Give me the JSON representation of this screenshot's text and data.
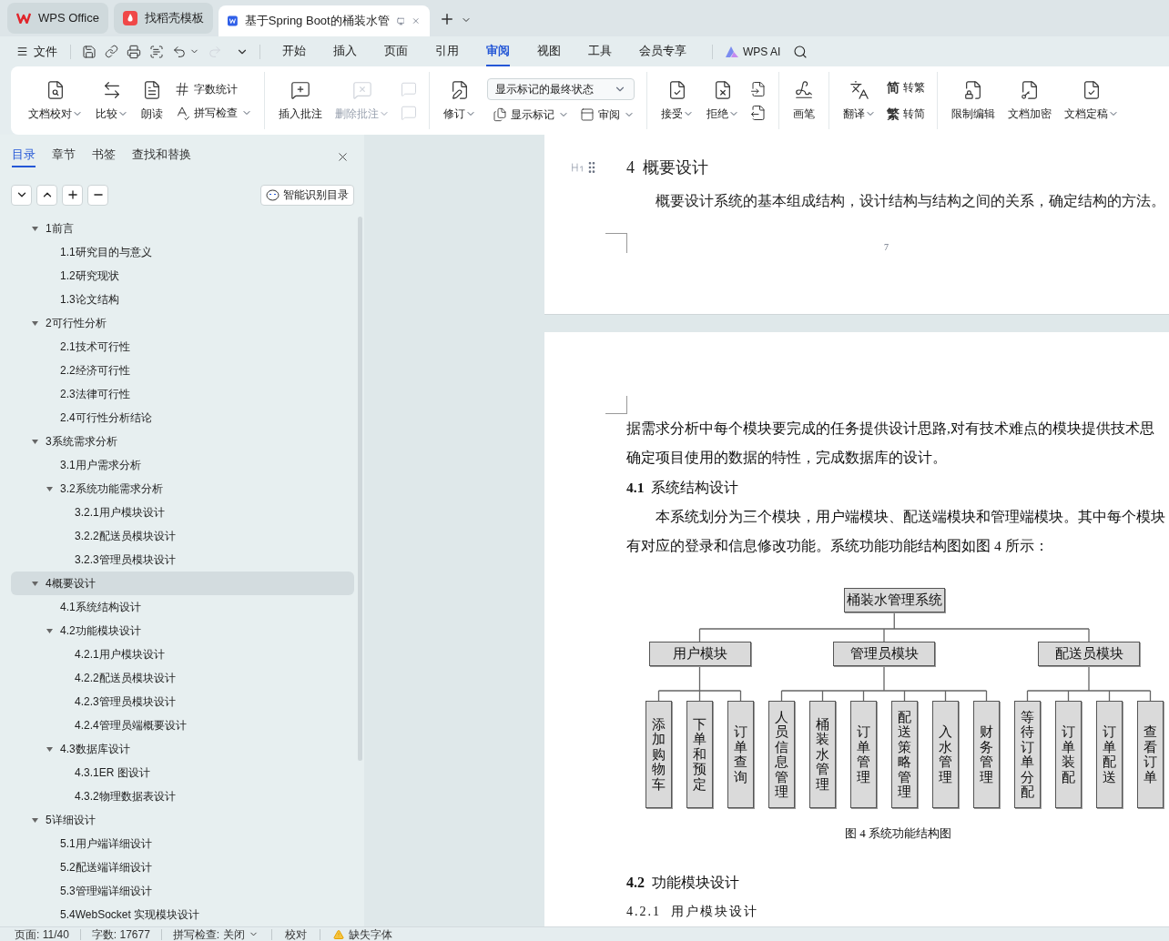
{
  "browser_tabs": [
    {
      "kind": "home",
      "label": "WPS Office",
      "selected": false
    },
    {
      "kind": "template",
      "label": "找稻壳模板",
      "selected": false
    },
    {
      "kind": "doc",
      "label": "基于Spring Boot的桶装水管",
      "selected": true
    }
  ],
  "menu": {
    "file": "文件",
    "tabs": [
      {
        "label": "开始",
        "selected": false
      },
      {
        "label": "插入",
        "selected": false
      },
      {
        "label": "页面",
        "selected": false
      },
      {
        "label": "引用",
        "selected": false
      },
      {
        "label": "审阅",
        "selected": true
      },
      {
        "label": "视图",
        "selected": false
      },
      {
        "label": "工具",
        "selected": false
      },
      {
        "label": "会员专享",
        "selected": false
      }
    ],
    "ai": "WPS AI"
  },
  "ribbon": [
    {
      "controls": [
        {
          "kind": "big",
          "label": "文档校对",
          "has_menu": true,
          "disabled": false
        },
        {
          "kind": "big",
          "label": "比较",
          "has_menu": true,
          "disabled": false
        },
        {
          "kind": "big",
          "label": "朗读",
          "has_menu": false,
          "disabled": false
        },
        {
          "kind": "stack",
          "items": [
            {
              "label": "字数统计",
              "has_menu": false,
              "disabled": false
            },
            {
              "label": "拼写检查",
              "has_menu": true,
              "disabled": false
            }
          ]
        }
      ]
    },
    {
      "controls": [
        {
          "kind": "big",
          "label": "插入批注",
          "has_menu": false,
          "disabled": false
        },
        {
          "kind": "big",
          "label": "删除批注",
          "has_menu": true,
          "disabled": true
        },
        {
          "kind": "stack",
          "items": [
            {
              "has_menu": false,
              "disabled": true
            },
            {
              "has_menu": false,
              "disabled": true
            }
          ]
        }
      ]
    },
    {
      "controls": [
        {
          "kind": "big",
          "label": "修订",
          "has_menu": true,
          "disabled": false
        },
        {
          "kind": "panel",
          "select": "显示标记的最终状态",
          "items": [
            {
              "label": "显示标记",
              "has_menu": true,
              "disabled": false
            },
            {
              "label": "审阅",
              "has_menu": true,
              "disabled": false
            }
          ]
        }
      ]
    },
    {
      "controls": [
        {
          "kind": "big",
          "label": "接受",
          "has_menu": true,
          "disabled": false
        },
        {
          "kind": "big",
          "label": "拒绝",
          "has_menu": true,
          "disabled": false
        },
        {
          "kind": "stack",
          "items": [
            {
              "has_menu": false,
              "disabled": false
            },
            {
              "has_menu": false,
              "disabled": false
            }
          ]
        }
      ]
    },
    {
      "controls": [
        {
          "kind": "big",
          "label": "画笔",
          "has_menu": false,
          "disabled": false
        }
      ]
    },
    {
      "controls": [
        {
          "kind": "big",
          "label": "翻译",
          "has_menu": true,
          "disabled": false
        },
        {
          "kind": "stack",
          "items": [
            {
              "glyph": "简",
              "label": "转繁",
              "has_menu": false,
              "disabled": false
            },
            {
              "glyph": "繁",
              "label": "转简",
              "has_menu": false,
              "disabled": false
            }
          ]
        }
      ]
    },
    {
      "controls": [
        {
          "kind": "big",
          "label": "限制编辑",
          "has_menu": false,
          "disabled": false
        },
        {
          "kind": "big",
          "label": "文档加密",
          "has_menu": false,
          "disabled": false
        },
        {
          "kind": "big",
          "label": "文档定稿",
          "has_menu": true,
          "disabled": false
        }
      ]
    }
  ],
  "sidebar": {
    "tabs": [
      {
        "label": "目录",
        "selected": true
      },
      {
        "label": "章节",
        "selected": false
      },
      {
        "label": "书签",
        "selected": false
      },
      {
        "label": "查找和替换",
        "selected": false
      }
    ],
    "smart_toc_button": "智能识别目录"
  },
  "toc": {
    "items": [
      {
        "label": "1前言",
        "selected": false,
        "expanded": true,
        "children": [
          {
            "label": "1.1研究目的与意义",
            "selected": false
          },
          {
            "label": "1.2研究现状",
            "selected": false
          },
          {
            "label": "1.3论文结构",
            "selected": false
          }
        ]
      },
      {
        "label": "2可行性分析",
        "selected": false,
        "expanded": true,
        "children": [
          {
            "label": "2.1技术可行性",
            "selected": false
          },
          {
            "label": "2.2经济可行性",
            "selected": false
          },
          {
            "label": "2.3法律可行性",
            "selected": false
          },
          {
            "label": "2.4可行性分析结论",
            "selected": false
          }
        ]
      },
      {
        "label": "3系统需求分析",
        "selected": false,
        "expanded": true,
        "children": [
          {
            "label": "3.1用户需求分析",
            "selected": false
          },
          {
            "label": "3.2系统功能需求分析",
            "selected": false,
            "expanded": true,
            "children": [
              {
                "label": "3.2.1用户模块设计",
                "selected": false
              },
              {
                "label": "3.2.2配送员模块设计",
                "selected": false
              },
              {
                "label": "3.2.3管理员模块设计",
                "selected": false
              }
            ]
          }
        ]
      },
      {
        "label": "4概要设计",
        "selected": true,
        "expanded": true,
        "children": [
          {
            "label": "4.1系统结构设计",
            "selected": false
          },
          {
            "label": "4.2功能模块设计",
            "selected": false,
            "expanded": true,
            "children": [
              {
                "label": "4.2.1用户模块设计",
                "selected": false
              },
              {
                "label": "4.2.2配送员模块设计",
                "selected": false
              },
              {
                "label": "4.2.3管理员模块设计",
                "selected": false
              },
              {
                "label": "4.2.4管理员端概要设计",
                "selected": false
              }
            ]
          },
          {
            "label": "4.3数据库设计",
            "selected": false,
            "expanded": true,
            "children": [
              {
                "label": "4.3.1ER 图设计",
                "selected": false
              },
              {
                "label": "4.3.2物理数据表设计",
                "selected": false
              }
            ]
          }
        ]
      },
      {
        "label": "5详细设计",
        "selected": false,
        "expanded": true,
        "children": [
          {
            "label": "5.1用户端详细设计",
            "selected": false
          },
          {
            "label": "5.2配送端详细设计",
            "selected": false
          },
          {
            "label": "5.3管理端详细设计",
            "selected": false
          },
          {
            "label": "5.4WebSocket 实现模块设计",
            "selected": false
          }
        ]
      }
    ]
  },
  "document": {
    "page_1": {
      "heading_number": "4",
      "heading": "概要设计",
      "paragraph": "概要设计系统的基本组成结构，设计结构与结构之间的关系，确定结构的方法。",
      "page_number": "7"
    },
    "page_2": {
      "lines": [
        "据需求分析中每个模块要完成的任务提供设计思路,对有技术难点的模块提供技术思",
        "确定项目使用的数据的特性，完成数据库的设计。"
      ],
      "section": {
        "number": "4.1",
        "title": "系统结构设计"
      },
      "body": [
        "本系统划分为三个模块，用户端模块、配送端模块和管理端模块。其中每个模块",
        "有对应的登录和信息修改功能。系统功能功能结构图如图 4 所示："
      ],
      "diagram": {
        "root": "桶装水管理系统",
        "modules": [
          {
            "label": "用户模块",
            "children": [
              "添加购物车",
              "下单和预定",
              "订单查询"
            ]
          },
          {
            "label": "管理员模块",
            "children": [
              "人员信息管理",
              "桶装水管理",
              "订单管理",
              "配送策略管理",
              "入水管理",
              "财务管理"
            ]
          },
          {
            "label": "配送员模块",
            "children": [
              "等待订单分配",
              "订单装配",
              "订单配送",
              "查看订单"
            ]
          }
        ]
      },
      "caption": "图 4  系统功能结构图",
      "section_2": {
        "number": "4.2",
        "title": "功能模块设计"
      },
      "subsection": {
        "number": "4.2.1",
        "title": "用户模块设计"
      }
    }
  },
  "status_bar": {
    "page": "页面: 11/40",
    "words": "字数: 17677",
    "spell": "拼写检查: 关闭",
    "proof": "校对",
    "fonts": "缺失字体"
  }
}
